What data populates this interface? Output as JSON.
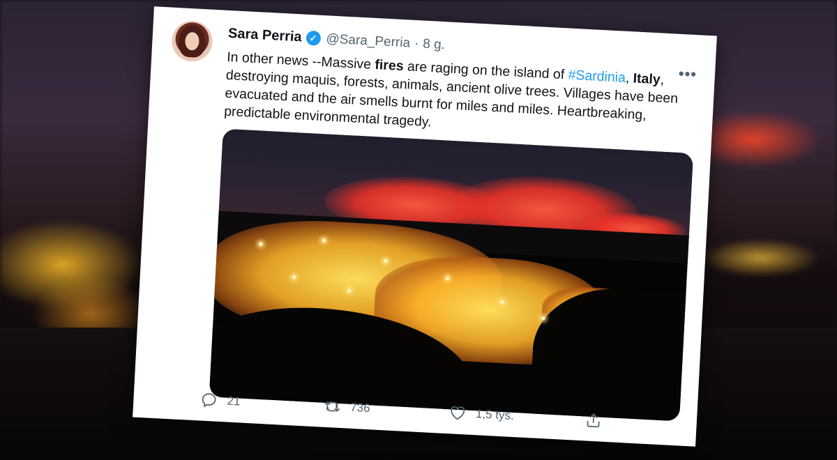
{
  "tweet": {
    "author_name": "Sara Perria",
    "handle": "@Sara_Perria",
    "separator": "·",
    "time": "8 g.",
    "more_label": "•••",
    "text": {
      "part1": "In other news --Massive ",
      "bold1": "fires",
      "part2": " are raging on the island of ",
      "hashtag": "#Sardinia",
      "part3": ", ",
      "bold2": "Italy",
      "part4": ", destroying maquis, forests, animals, ancient olive trees. Villages have been evacuated and the air smells burnt for miles and miles. Heartbreaking, predictable environmental tragedy."
    },
    "actions": {
      "replies": "21",
      "retweets": "736",
      "likes": "1,5 tys."
    },
    "icons": {
      "verified": "verified-badge-icon",
      "reply": "reply-icon",
      "retweet": "retweet-icon",
      "like": "heart-icon",
      "share": "share-icon"
    },
    "colors": {
      "hashtag": "#1d9bf0",
      "verified": "#1d9bf0",
      "muted": "#536471"
    }
  }
}
